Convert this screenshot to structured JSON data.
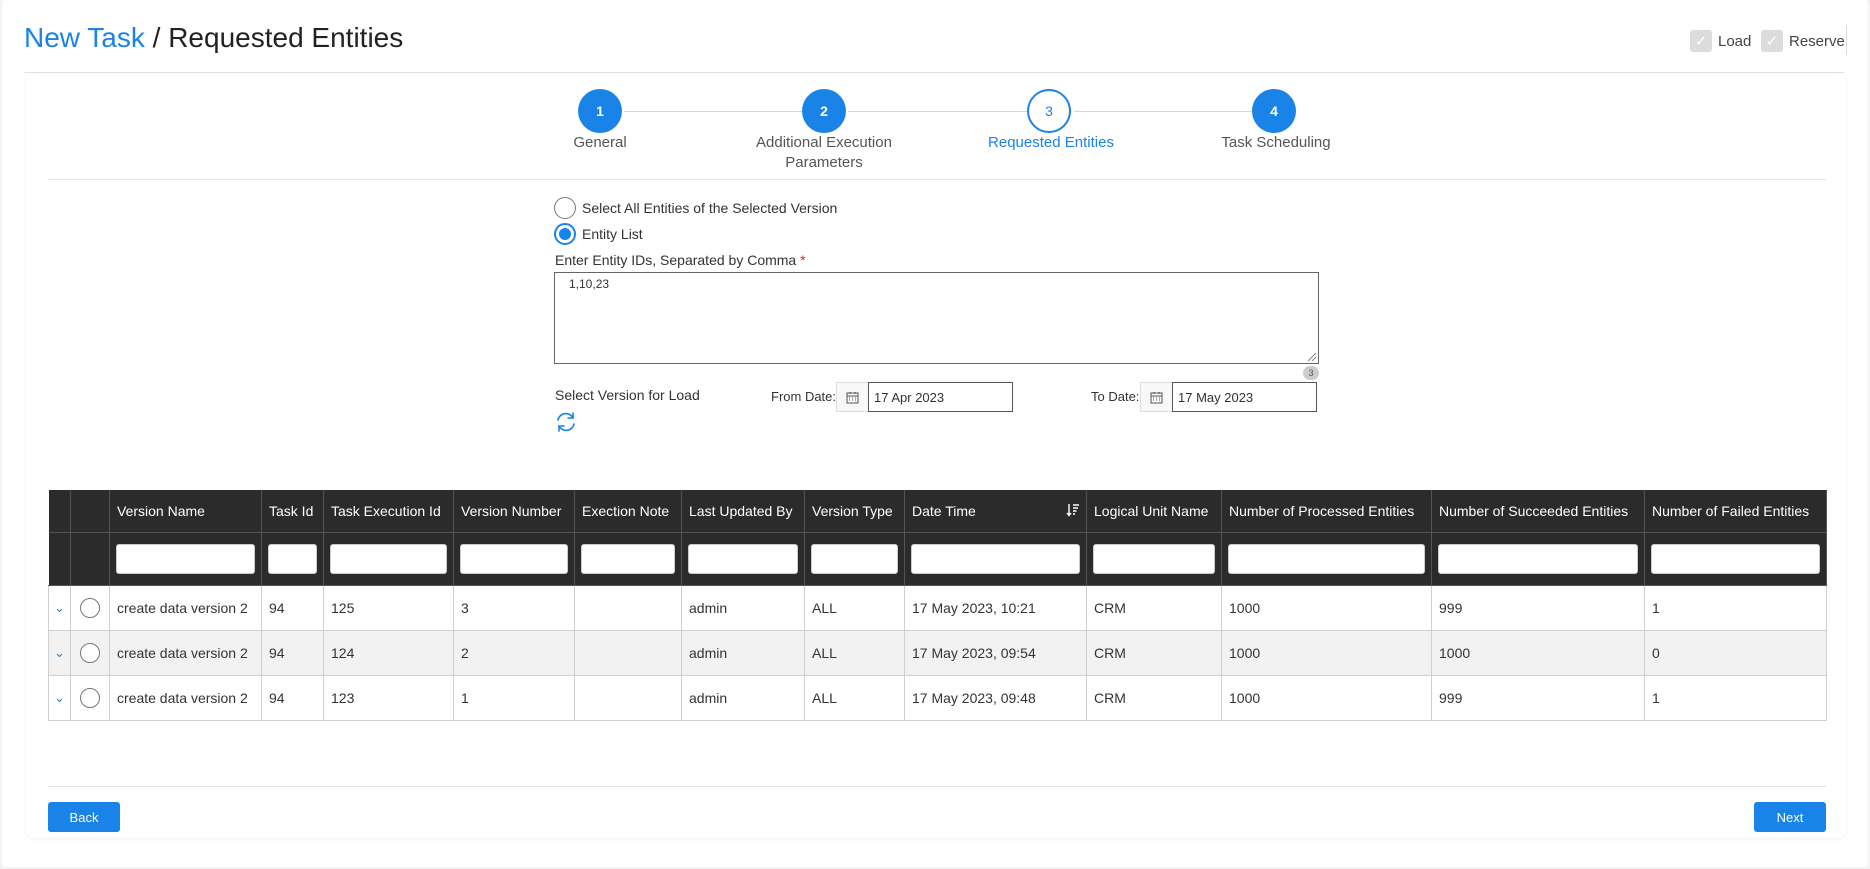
{
  "header": {
    "title_link": "New Task",
    "title_sep": " / ",
    "title_current": "Requested Entities",
    "checks": [
      {
        "label": "Load",
        "checked": true
      },
      {
        "label": "Reserve",
        "checked": true
      }
    ]
  },
  "steps": [
    {
      "number": "1",
      "label": "General",
      "state": "done"
    },
    {
      "number": "2",
      "label": "Additional Execution Parameters",
      "state": "done"
    },
    {
      "number": "3",
      "label": "Requested Entities",
      "state": "current"
    },
    {
      "number": "4",
      "label": "Task Scheduling",
      "state": "done"
    }
  ],
  "form": {
    "radio_all_label": "Select All Entities of the Selected Version",
    "radio_list_label": "Entity List",
    "selected_option": "Entity List",
    "ids_label": "Enter Entity IDs, Separated by Comma",
    "ids_required_mark": "*",
    "ids_value": "1,10,23",
    "ids_count": "3",
    "version_label": "Select Version for Load",
    "from_date_label": "From Date:",
    "from_date_value": "17 Apr 2023",
    "to_date_label": "To Date:",
    "to_date_value": "17 May 2023"
  },
  "table": {
    "columns": [
      "Version Name",
      "Task Id",
      "Task Execution Id",
      "Version Number",
      "Exection Note",
      "Last Updated By",
      "Version Type",
      "Date Time",
      "Logical Unit Name",
      "Number of Processed Entities",
      "Number of Succeeded Entities",
      "Number of Failed Entities"
    ],
    "sorted_column": "Date Time",
    "rows": [
      [
        "create data version 2",
        "94",
        "125",
        "3",
        "",
        "admin",
        "ALL",
        "17 May 2023, 10:21",
        "CRM",
        "1000",
        "999",
        "1"
      ],
      [
        "create data version 2",
        "94",
        "124",
        "2",
        "",
        "admin",
        "ALL",
        "17 May 2023, 09:54",
        "CRM",
        "1000",
        "1000",
        "0"
      ],
      [
        "create data version 2",
        "94",
        "123",
        "1",
        "",
        "admin",
        "ALL",
        "17 May 2023, 09:48",
        "CRM",
        "1000",
        "999",
        "1"
      ]
    ]
  },
  "footer": {
    "back_label": "Back",
    "next_label": "Next"
  },
  "colors": {
    "accent": "#1a83e8",
    "table_header": "#2b2b2b",
    "required": "#e0262f"
  }
}
